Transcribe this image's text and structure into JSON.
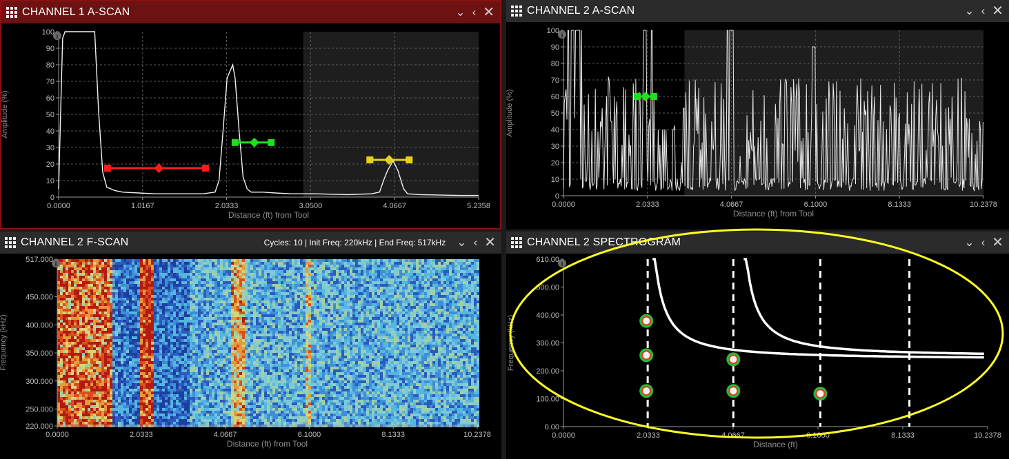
{
  "panels": [
    {
      "title": "CHANNEL 1 A-SCAN",
      "xlabel": "Distance (ft) from Tool",
      "ylabel": "Amplitude (%)",
      "xticks": [
        "0.0000",
        "1.0167",
        "2.0333",
        "3.0500",
        "4.0667",
        "5.2358"
      ],
      "yticks": [
        "0",
        "10",
        "20",
        "30",
        "40",
        "50",
        "60",
        "70",
        "80",
        "90",
        "100"
      ]
    },
    {
      "title": "CHANNEL 2 A-SCAN",
      "xlabel": "Distance (ft) from Tool",
      "ylabel": "Amplitude (%)",
      "xticks": [
        "0.0000",
        "2.0333",
        "4.0667",
        "6.1000",
        "8.1333",
        "10.2378"
      ],
      "yticks": [
        "0",
        "10",
        "20",
        "30",
        "40",
        "50",
        "60",
        "70",
        "80",
        "90",
        "100"
      ]
    },
    {
      "title": "CHANNEL 2 F-SCAN",
      "info": "Cycles: 10 |  Init Freq: 220kHz |  End Freq: 517kHz",
      "xlabel": "Distance (ft) from Tool",
      "ylabel": "Frequency (kHz)",
      "xticks": [
        "0.0000",
        "2.0333",
        "4.0667",
        "6.1000",
        "8.1333",
        "10.2378"
      ],
      "yticks": [
        "517.000",
        "450.000",
        "400.000",
        "350.000",
        "300.000",
        "250.000",
        "220.000"
      ]
    },
    {
      "title": "CHANNEL 2 SPECTROGRAM",
      "xlabel": "Distance (ft)",
      "ylabel": "Frequency (kHz)",
      "xticks": [
        "0.0000",
        "2.0333",
        "4.0667",
        "6.1000",
        "8.1333",
        "10.2378"
      ],
      "yticks": [
        "0.00",
        "100.00",
        "200.00",
        "300.00",
        "400.00",
        "500.00",
        "610.00"
      ]
    }
  ],
  "icons": {
    "menu": "grid-icon",
    "collapse": "chevron-down-icon",
    "back": "chevron-left-icon",
    "close": "close-icon",
    "info": "info-icon"
  },
  "colors": {
    "active_header": "#6d1212",
    "header": "#2b2b2b",
    "gate1": "#ff1a1a",
    "gate2": "#22dd22",
    "gate3": "#e6d21a",
    "annotation": "#ffff22"
  },
  "chart_data": [
    {
      "type": "line",
      "title": "CHANNEL 1 A-SCAN",
      "xlabel": "Distance (ft) from Tool",
      "ylabel": "Amplitude (%)",
      "xlim": [
        0,
        5.2358
      ],
      "ylim": [
        0,
        100
      ],
      "grid": true,
      "series": [
        {
          "x": [
            0,
            0.05,
            0.08,
            0.12,
            0.3,
            0.45,
            0.5,
            0.55,
            0.6,
            0.7,
            0.8,
            1.0,
            1.2,
            1.5,
            1.8,
            1.95,
            2.0,
            2.05,
            2.1,
            2.17,
            2.2,
            2.25,
            2.3,
            2.35,
            2.4,
            2.55,
            2.7,
            2.9,
            3.2,
            3.6,
            3.9,
            4.0,
            4.05,
            4.1,
            4.17,
            4.23,
            4.3,
            4.35,
            4.5,
            5.0,
            5.2358
          ],
          "y": [
            5,
            96,
            100,
            100,
            100,
            100,
            50,
            15,
            6,
            4,
            3,
            2.5,
            2,
            2,
            2,
            3,
            10,
            40,
            72,
            80,
            72,
            40,
            12,
            5,
            3,
            3,
            2.5,
            2,
            2,
            1.5,
            2,
            3,
            10,
            16,
            22,
            16,
            5,
            2,
            1.5,
            1,
            1
          ]
        }
      ],
      "gates": [
        {
          "start": 0.61,
          "end": 1.83,
          "level": 17.5,
          "marker": 1.25
        },
        {
          "start": 2.2,
          "end": 2.65,
          "level": 33,
          "marker": 2.44
        },
        {
          "start": 3.88,
          "end": 4.37,
          "level": 22.5,
          "marker": 4.12
        }
      ]
    },
    {
      "type": "line",
      "title": "CHANNEL 2 A-SCAN",
      "xlabel": "Distance (ft) from Tool",
      "ylabel": "Amplitude (%)",
      "xlim": [
        0,
        10.2378
      ],
      "ylim": [
        0,
        100
      ],
      "grid": true,
      "gates": [
        {
          "start": 1.8,
          "end": 2.2,
          "level": 60,
          "marker": 2.0
        }
      ]
    },
    {
      "type": "heatmap",
      "title": "CHANNEL 2 F-SCAN",
      "xlabel": "Distance (ft) from Tool",
      "ylabel": "Frequency (kHz)",
      "xlim": [
        0,
        10.2378
      ],
      "ylim": [
        220,
        517
      ],
      "hot_bands_ft": [
        0.25,
        0.7,
        1.1,
        2.1,
        4.35,
        6.1
      ]
    },
    {
      "type": "scatter",
      "title": "CHANNEL 2 SPECTROGRAM",
      "xlabel": "Distance (ft)",
      "ylabel": "Frequency (kHz)",
      "xlim": [
        0,
        10.2378
      ],
      "ylim": [
        0,
        610
      ],
      "dashed_lines_x": [
        2.0333,
        4.1,
        6.2,
        8.35
      ],
      "blobs": [
        {
          "x": 2.0,
          "y": 130
        },
        {
          "x": 2.0,
          "y": 260
        },
        {
          "x": 2.0,
          "y": 385
        },
        {
          "x": 4.1,
          "y": 130
        },
        {
          "x": 4.1,
          "y": 245
        },
        {
          "x": 6.2,
          "y": 120
        }
      ]
    }
  ]
}
